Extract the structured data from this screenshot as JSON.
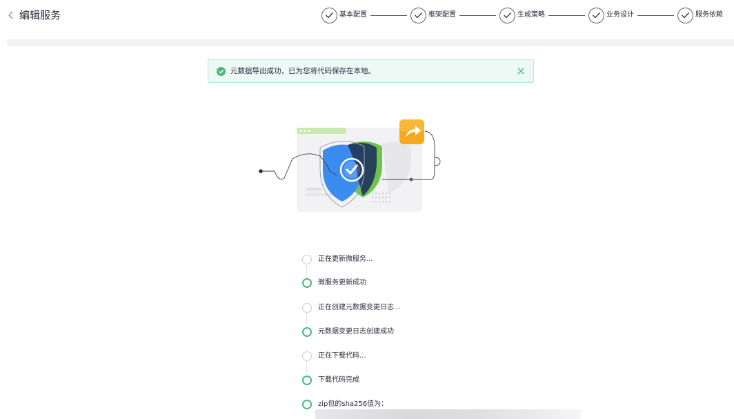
{
  "header": {
    "title": "编辑服务",
    "steps": [
      {
        "label": "基本配置"
      },
      {
        "label": "框架配置"
      },
      {
        "label": "生成策略"
      },
      {
        "label": "业务设计"
      },
      {
        "label": "服务依赖"
      }
    ]
  },
  "alert": {
    "type": "success",
    "message": "元数据导出成功，已为您将代码保存在本地。"
  },
  "timeline": [
    {
      "text": "正在更新微服务...",
      "status": "pending"
    },
    {
      "text": "微服务更新成功",
      "status": "done"
    },
    {
      "text": "正在创建元数据变更日志...",
      "status": "pending"
    },
    {
      "text": "元数据变更日志创建成功",
      "status": "done"
    },
    {
      "text": "正在下载代码...",
      "status": "pending"
    },
    {
      "text": "下载代码完成",
      "status": "done"
    },
    {
      "text": "zip包的sha256值为：",
      "status": "done"
    }
  ],
  "colors": {
    "success": "#4cb77f",
    "pending": "#c8cbe6",
    "alert_bg": "#edf9f5",
    "shield_blue": "#3b8cf0",
    "shield_green": "#6cc44a",
    "shield_dark": "#243a5e",
    "share_orange": "#f7a81f"
  }
}
